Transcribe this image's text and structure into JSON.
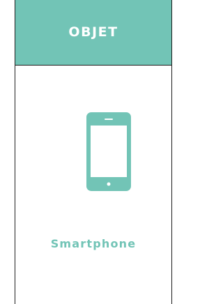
{
  "card": {
    "title": "OBJET",
    "label": "Smartphone",
    "icon": "smartphone-icon"
  },
  "colors": {
    "accent": "#72c4b6",
    "border": "#1b1b1b",
    "background": "#ffffff"
  }
}
